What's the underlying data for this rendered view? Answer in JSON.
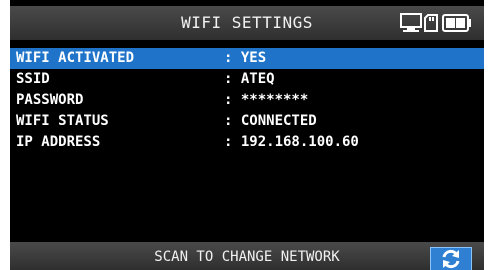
{
  "header": {
    "title": "WIFI SETTINGS",
    "icons": [
      "computer-icon",
      "sd-card-icon",
      "battery-icon"
    ]
  },
  "settings": [
    {
      "label": "WIFI ACTIVATED",
      "value": ": YES",
      "selected": true
    },
    {
      "label": "SSID",
      "value": ": ATEQ",
      "selected": false
    },
    {
      "label": "PASSWORD",
      "value": ": ********",
      "selected": false
    },
    {
      "label": "WIFI STATUS",
      "value": ": CONNECTED",
      "selected": false
    },
    {
      "label": "IP ADDRESS",
      "value": ": 192.168.100.60",
      "selected": false
    }
  ],
  "footer": {
    "action_label": "SCAN TO CHANGE NETWORK",
    "button_icon": "refresh-icon"
  },
  "colors": {
    "selection": "#1f74c9",
    "background": "#000000",
    "bar": "#3c3c3c",
    "button": "#2f7fd3"
  }
}
